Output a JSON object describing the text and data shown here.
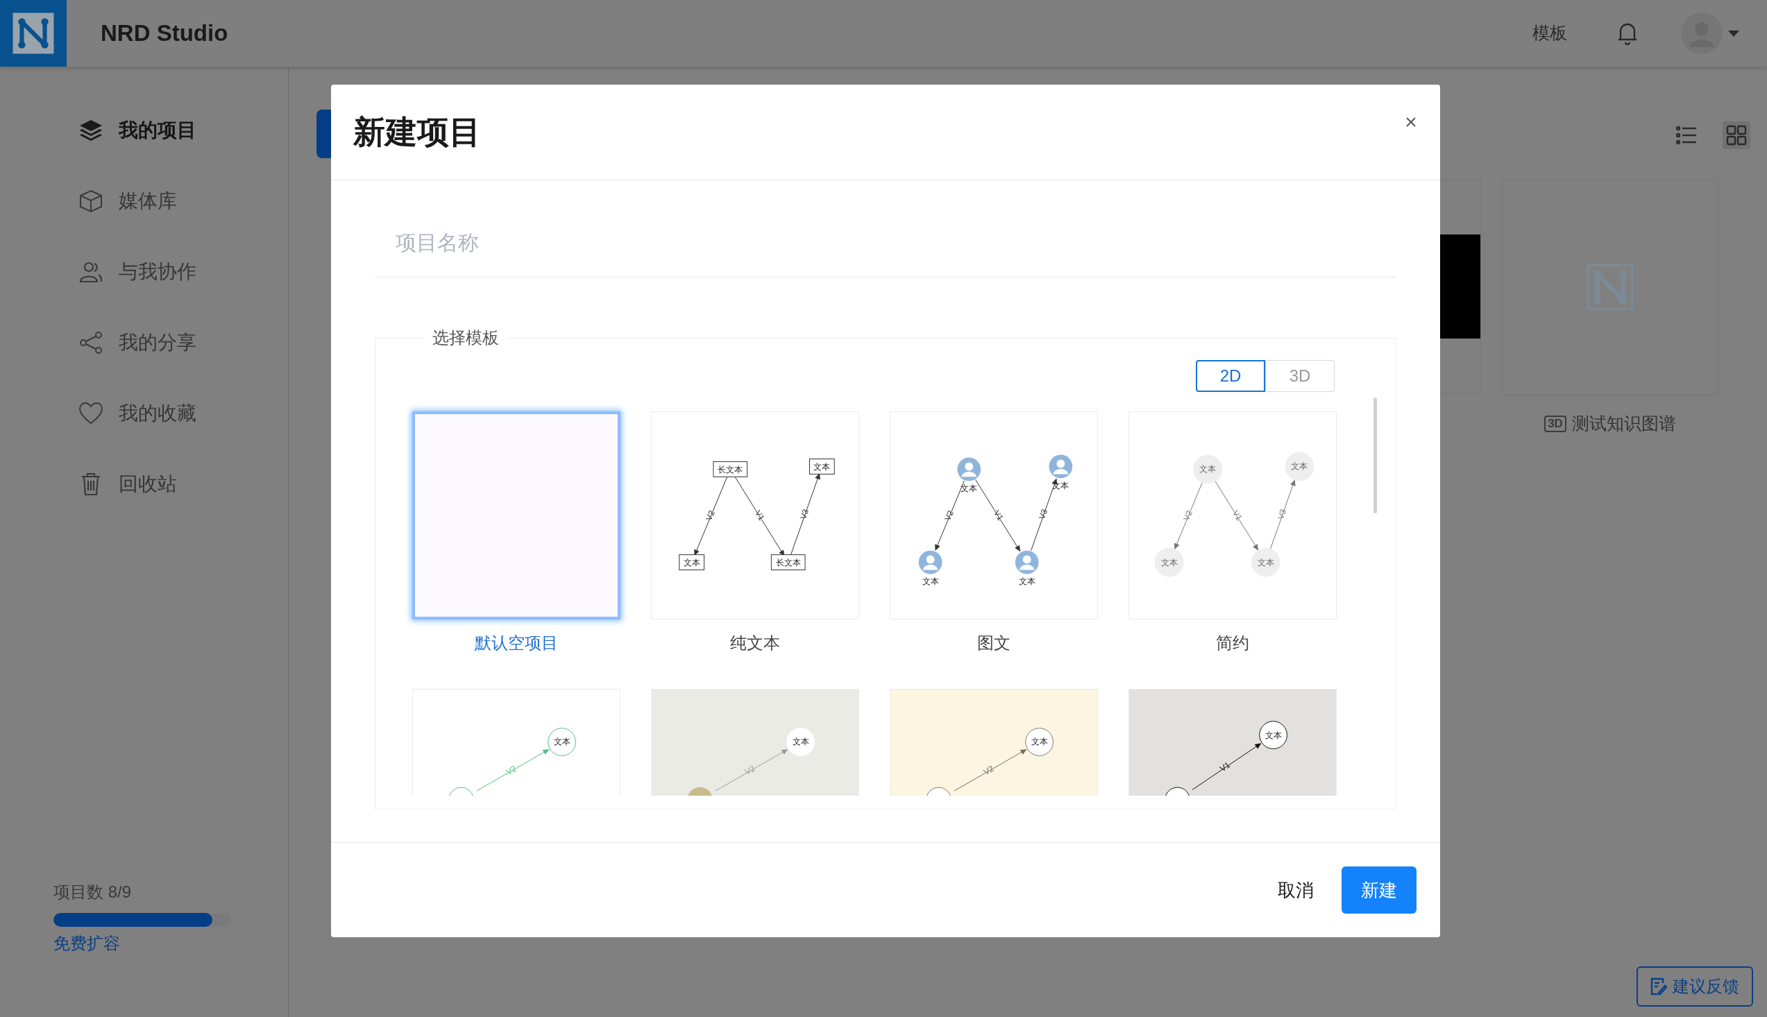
{
  "header": {
    "brand": "NRD Studio",
    "nav_link": "模板"
  },
  "sidebar": {
    "items": [
      {
        "kind": "layers",
        "label": "我的项目",
        "selected": true
      },
      {
        "kind": "cube",
        "label": "媒体库",
        "selected": false
      },
      {
        "kind": "users",
        "label": "与我协作",
        "selected": false
      },
      {
        "kind": "share",
        "label": "我的分享",
        "selected": false
      },
      {
        "kind": "heart",
        "label": "我的收藏",
        "selected": false
      },
      {
        "kind": "trash",
        "label": "回收站",
        "selected": false
      }
    ],
    "quota": {
      "label": "项目数 8/9",
      "level": 0.89,
      "link": "免费扩容"
    }
  },
  "view_toggle": [
    {
      "kind": "list",
      "selected": false
    },
    {
      "kind": "grid",
      "selected": true
    }
  ],
  "projects": [
    {
      "kind": "picture"
    },
    {
      "kind": "logo",
      "badge": "3D",
      "title": "测试知识图谱"
    }
  ],
  "feedback_button": "建议反馈",
  "dialog": {
    "title": "新建项目",
    "name_field": {
      "placeholder": "项目名称"
    },
    "section_title": "选择模板",
    "dimension_tabs": [
      {
        "label": "2D",
        "selected": true
      },
      {
        "label": "3D",
        "selected": false
      }
    ],
    "templates": [
      {
        "kind": "blank",
        "label": "默认空项目",
        "selected": true
      },
      {
        "kind": "text",
        "label": "纯文本",
        "selected": false,
        "nodes": [
          "长文本",
          "文本",
          "文本",
          "长文本"
        ],
        "edges": [
          "V2",
          "V1",
          "V3"
        ]
      },
      {
        "label": "图文",
        "selected": false,
        "nodes": [
          "文本",
          "文本",
          "文本",
          "文本"
        ],
        "edges": [
          "V2",
          "V1",
          "V3"
        ]
      },
      {
        "kind": "simple",
        "label": "简约",
        "selected": false,
        "nodes": [
          "文本",
          "文本",
          "文本",
          "文本"
        ],
        "edges": [
          "V2",
          "V1",
          "V3"
        ]
      },
      {
        "kind": "line",
        "color": "#ffffff",
        "selected": false,
        "nodes": [
          "文本"
        ],
        "edges": [
          "V2"
        ]
      },
      {
        "kind": "line",
        "color": "#ebebe6",
        "selected": false,
        "nodes": [
          "文本"
        ],
        "edges": [
          "V2"
        ]
      },
      {
        "kind": "line",
        "color": "#fbf5e1",
        "selected": false,
        "nodes": [
          "文本"
        ],
        "edges": [
          "V2"
        ]
      },
      {
        "kind": "line",
        "color": "#e2e1de",
        "selected": false,
        "nodes": [
          "文本"
        ],
        "edges": [
          "V1"
        ]
      }
    ],
    "buttons": [
      {
        "kind": "cancel",
        "label": "取消"
      },
      {
        "kind": "primary",
        "label": "新建"
      }
    ]
  }
}
